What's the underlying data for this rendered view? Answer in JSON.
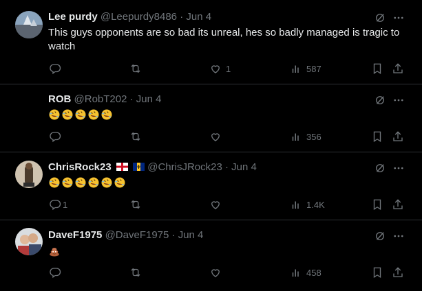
{
  "tweets": [
    {
      "name": "Lee purdy",
      "handle": "@Leepurdy8486",
      "dot": "·",
      "date": "Jun 4",
      "text": "This guys opponents are so bad its unreal, hes so badly managed is tragic to watch",
      "replies": "",
      "retweets": "",
      "likes": "1",
      "views": "587"
    },
    {
      "name": "ROB",
      "handle": "@RobT202",
      "dot": "·",
      "date": "Jun 4",
      "emoji": [
        "rolling-on-floor-laughing",
        "rolling-on-floor-laughing",
        "rolling-on-floor-laughing",
        "rolling-on-floor-laughing",
        "rolling-on-floor-laughing"
      ],
      "replies": "",
      "retweets": "",
      "likes": "",
      "views": "356"
    },
    {
      "name": "ChrisRock23",
      "flags": [
        "england",
        "barbados"
      ],
      "handle": "@ChrisJRock23",
      "dot": "·",
      "date": "Jun 4",
      "emoji": [
        "rolling-on-floor-laughing",
        "rolling-on-floor-laughing",
        "rolling-on-floor-laughing",
        "rolling-on-floor-laughing",
        "rolling-on-floor-laughing",
        "rolling-on-floor-laughing"
      ],
      "replies": "1",
      "retweets": "",
      "likes": "",
      "views": "1.4K"
    },
    {
      "name": "DaveF1975",
      "handle": "@DaveF1975",
      "dot": "·",
      "date": "Jun 4",
      "emoji": [
        "pile-of-poo"
      ],
      "replies": "",
      "retweets": "",
      "likes": "",
      "views": "458"
    }
  ],
  "colors": {
    "background": "#000000",
    "text": "#e7e9ea",
    "muted": "#71767b",
    "divider": "#2f3336"
  },
  "icons": [
    "reply-icon",
    "retweet-icon",
    "like-icon",
    "views-icon",
    "bookmark-icon",
    "share-icon",
    "grok-icon",
    "more-icon"
  ]
}
